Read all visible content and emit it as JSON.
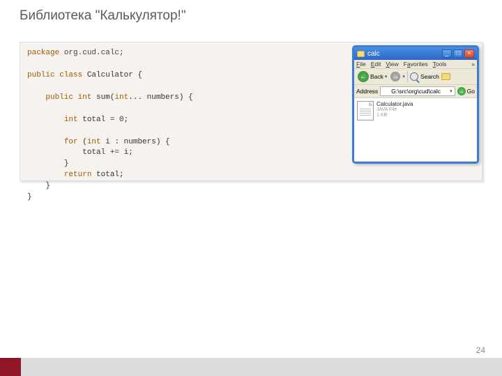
{
  "slide": {
    "title": "Библиотека \"Калькулятор!\"",
    "page_number": "24"
  },
  "code": {
    "kw_package": "package",
    "package_name": " org.cud.calc;",
    "kw_public1": "public",
    "kw_class": " class",
    "class_name": " Calculator {",
    "kw_public2": "public",
    "kw_int1": " int",
    "method_sig_a": " sum(",
    "kw_int2": "int",
    "method_sig_b": "... numbers) {",
    "kw_int3": "int",
    "var_decl": " total = 0;",
    "kw_for": "for",
    "for_open": " (",
    "kw_int4": "int",
    "for_rest": " i : numbers) {",
    "loop_body": "total += i;",
    "brace_close1": "}",
    "kw_return": "return",
    "return_expr": " total;",
    "brace_close2": "}",
    "brace_close3": "}"
  },
  "explorer": {
    "title": "calc",
    "menu": {
      "file": "File",
      "edit": "Edit",
      "view": "View",
      "favorites": "Favorites",
      "tools": "Tools",
      "more": "»"
    },
    "toolbar": {
      "back": "Back",
      "search": "Search"
    },
    "address": {
      "label": "Address",
      "path": "G:\\src\\org\\cud\\calc",
      "go": "Go"
    },
    "file": {
      "name": "Calculator.java",
      "type": "JAVA File",
      "size": "1 KB"
    }
  }
}
